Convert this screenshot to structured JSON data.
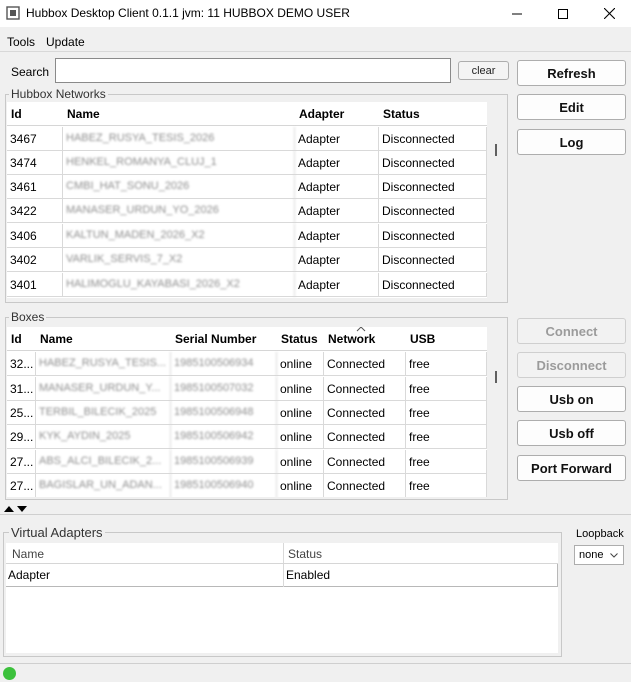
{
  "window": {
    "title": "Hubbox Desktop Client 0.1.1 jvm: 11 HUBBOX DEMO USER"
  },
  "menu": {
    "tools": "Tools",
    "update": "Update"
  },
  "search": {
    "label": "Search",
    "value": "",
    "placeholder": "",
    "clear_label": "clear"
  },
  "buttons": {
    "refresh": "Refresh",
    "edit": "Edit",
    "log": "Log",
    "connect": "Connect",
    "disconnect": "Disconnect",
    "usb_on": "Usb on",
    "usb_off": "Usb off",
    "port_forward": "Port Forward"
  },
  "networks": {
    "title": "Hubbox Networks",
    "columns": [
      "Id",
      "Name",
      "Adapter",
      "Status"
    ],
    "rows": [
      {
        "id": "3467",
        "name": "HABEZ_RUSYA_TESIS_2026",
        "adapter": "Adapter",
        "status": "Disconnected"
      },
      {
        "id": "3474",
        "name": "HENKEL_ROMANYA_CLUJ_1",
        "adapter": "Adapter",
        "status": "Disconnected"
      },
      {
        "id": "3461",
        "name": "CMBI_HAT_SONU_2026",
        "adapter": "Adapter",
        "status": "Disconnected"
      },
      {
        "id": "3422",
        "name": "MANASER_URDUN_YO_2026",
        "adapter": "Adapter",
        "status": "Disconnected"
      },
      {
        "id": "3406",
        "name": "KALTUN_MADEN_2026_X2",
        "adapter": "Adapter",
        "status": "Disconnected"
      },
      {
        "id": "3402",
        "name": "VARLIK_SERVIS_7_X2",
        "adapter": "Adapter",
        "status": "Disconnected"
      },
      {
        "id": "3401",
        "name": "HALIMOGLU_KAYABASI_2026_X2",
        "adapter": "Adapter",
        "status": "Disconnected"
      }
    ]
  },
  "boxes": {
    "title": "Boxes",
    "columns": [
      "Id",
      "Name",
      "Serial Number",
      "Status",
      "Network",
      "USB"
    ],
    "rows": [
      {
        "id": "32...",
        "name": "HABEZ_RUSYA_TESIS...",
        "serial": "1985100506934",
        "status": "online",
        "network": "Connected",
        "usb": "free"
      },
      {
        "id": "31...",
        "name": "MANASER_URDUN_Y...",
        "serial": "1985100507032",
        "status": "online",
        "network": "Connected",
        "usb": "free"
      },
      {
        "id": "25...",
        "name": "TERBIL_BILECIK_2025",
        "serial": "1985100506948",
        "status": "online",
        "network": "Connected",
        "usb": "free"
      },
      {
        "id": "29...",
        "name": "KYK_AYDIN_2025",
        "serial": "1985100506942",
        "status": "online",
        "network": "Connected",
        "usb": "free"
      },
      {
        "id": "27...",
        "name": "ABS_ALCI_BILECIK_2...",
        "serial": "1985100506939",
        "status": "online",
        "network": "Connected",
        "usb": "free"
      },
      {
        "id": "27...",
        "name": "BAGISLAR_UN_ADAN...",
        "serial": "1985100506940",
        "status": "online",
        "network": "Connected",
        "usb": "free"
      }
    ]
  },
  "virtual_adapters": {
    "title": "Virtual Adapters",
    "columns": [
      "Name",
      "Status"
    ],
    "rows": [
      {
        "name": "Adapter",
        "status": "Enabled"
      }
    ]
  },
  "loopback": {
    "label": "Loopback",
    "value": "none"
  },
  "colors": {
    "status_ok": "#3cc13c"
  }
}
